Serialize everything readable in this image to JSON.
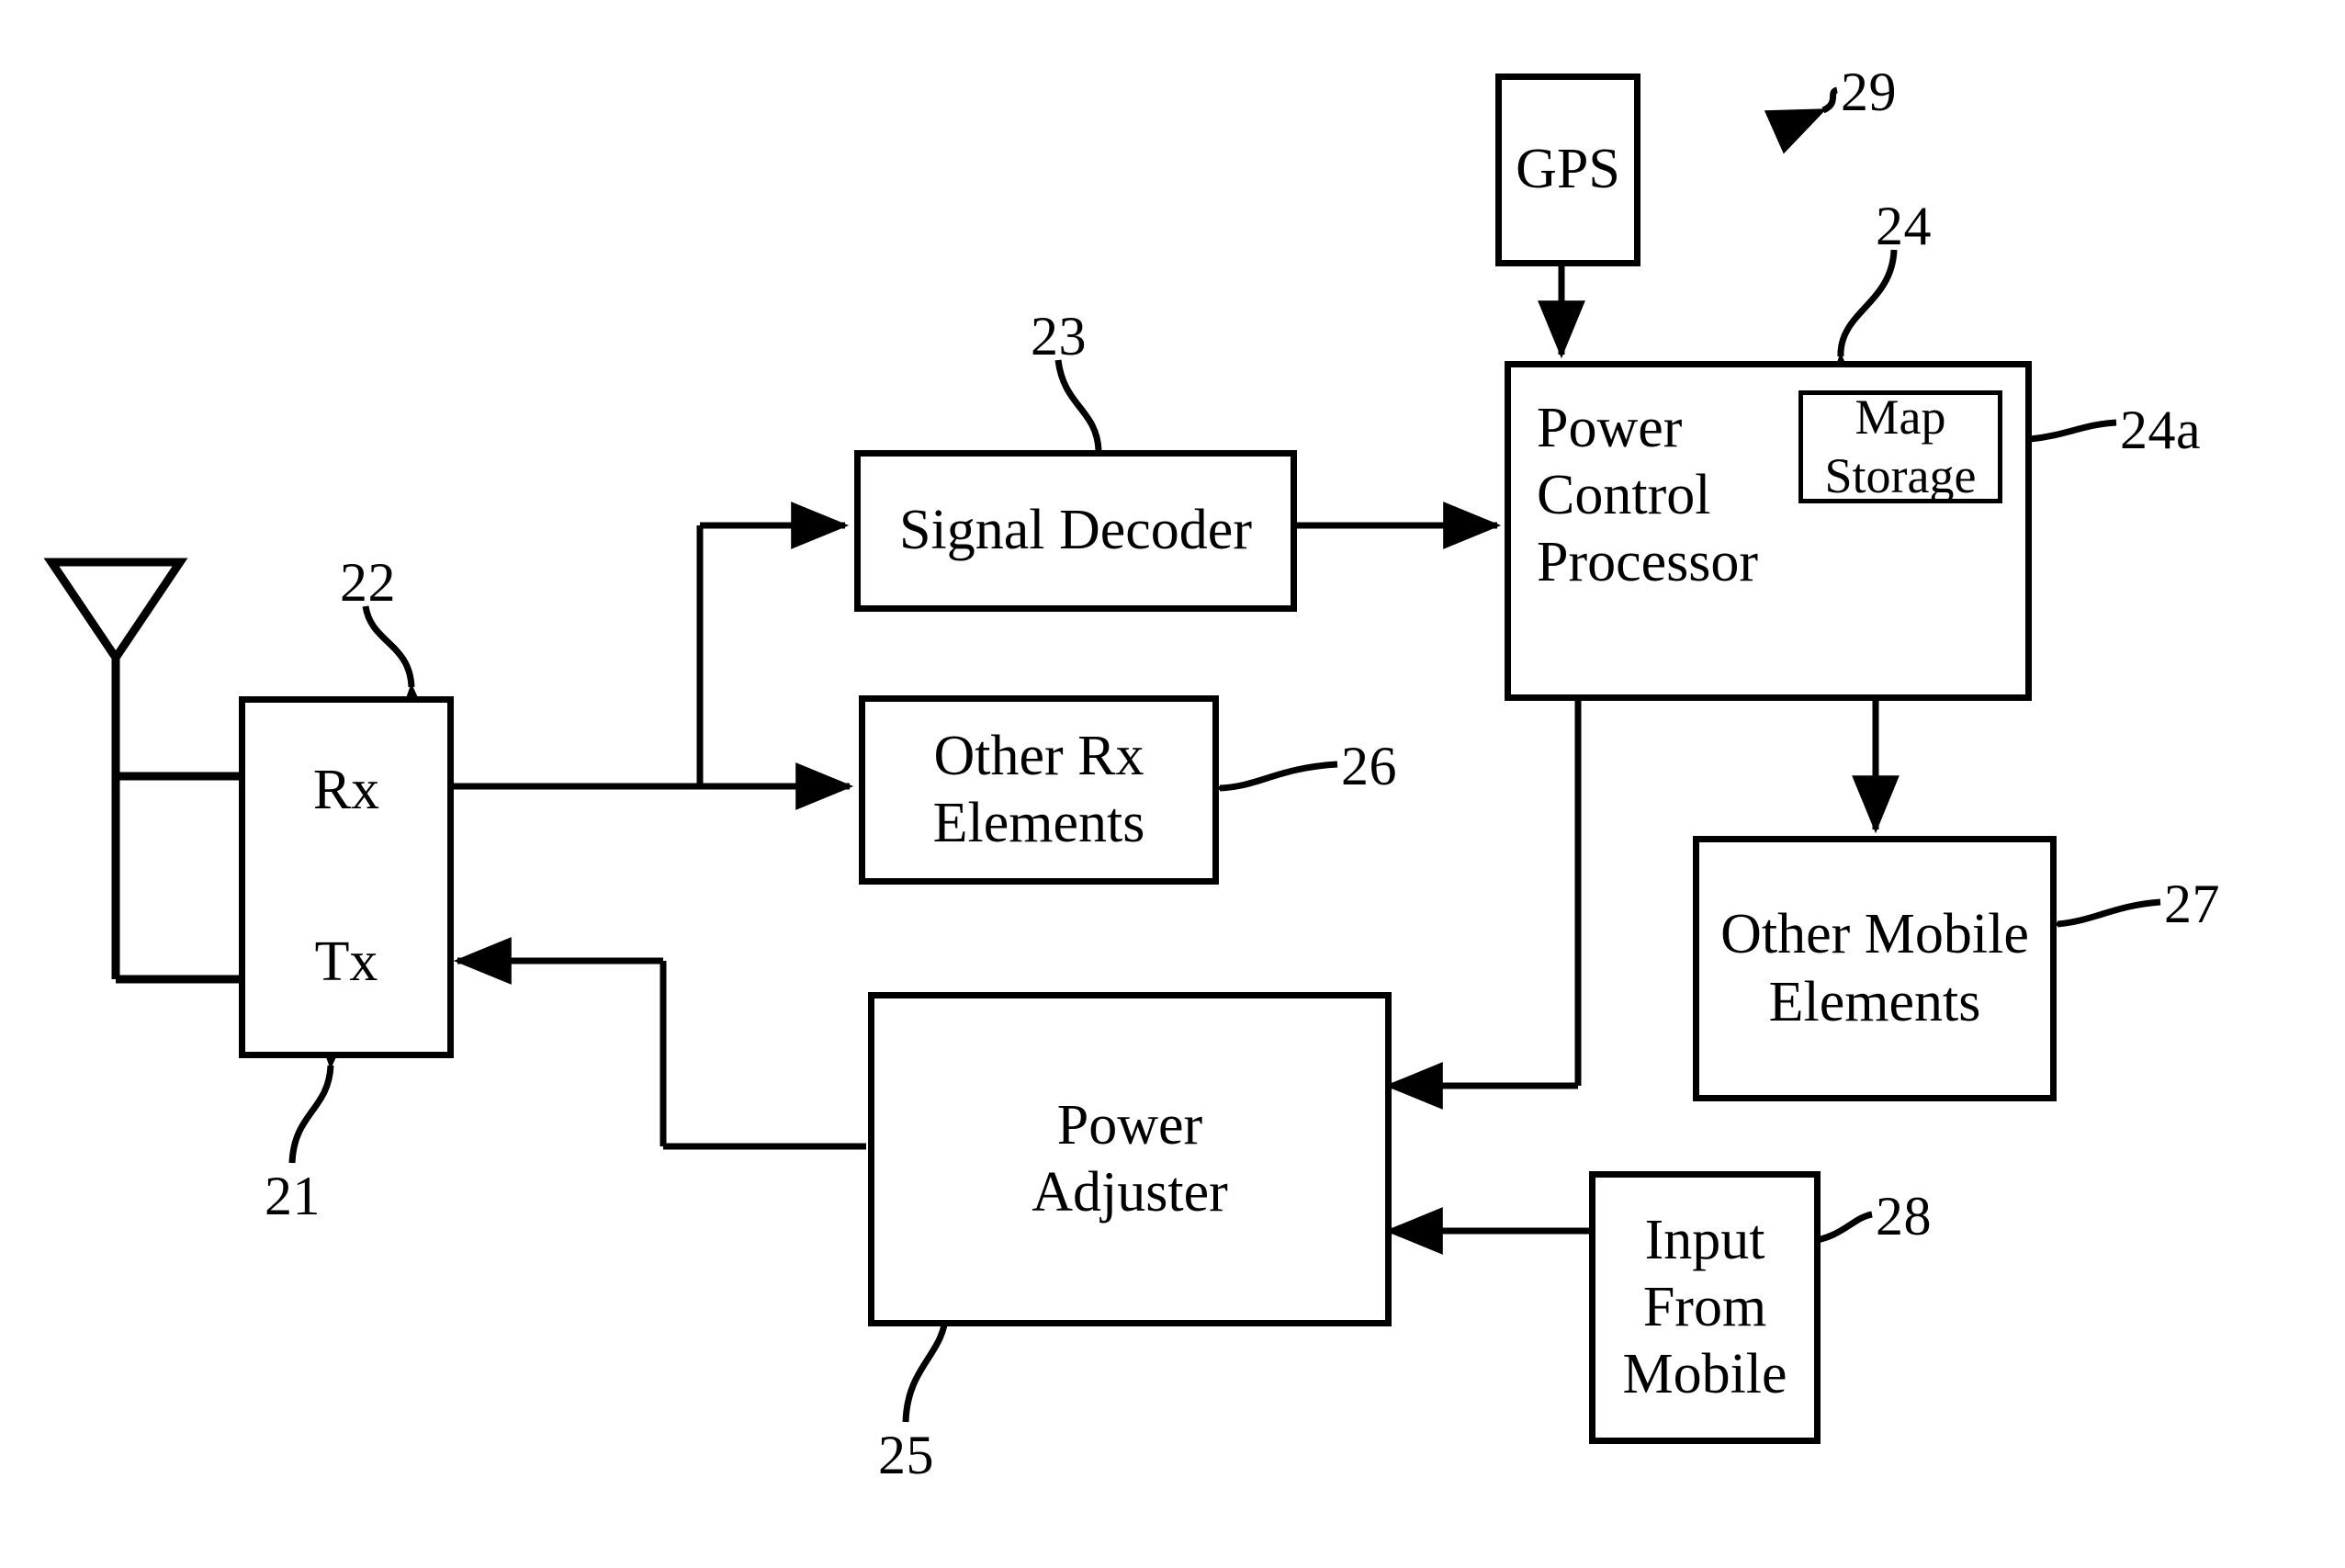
{
  "figure": {
    "type": "patent-block-diagram",
    "title": "Mobile transmit power control block diagram"
  },
  "blocks": {
    "rx": {
      "label": "Rx",
      "ref": "22"
    },
    "tx": {
      "label": "Tx",
      "ref": "21"
    },
    "signal_decoder": {
      "label": "Signal Decoder",
      "ref": "23"
    },
    "other_rx_elements": {
      "label": "Other Rx\nElements",
      "ref": "26"
    },
    "power_adjuster": {
      "label": "Power\nAdjuster",
      "ref": "25"
    },
    "power_control_processor": {
      "label": "Power\nControl\nProcessor",
      "ref": "24"
    },
    "map_storage": {
      "label": "Map\nStorage",
      "ref": "24a"
    },
    "gps": {
      "label": "GPS",
      "ref": "29"
    },
    "other_mobile_elements": {
      "label": "Other Mobile\nElements",
      "ref": "27"
    },
    "input_from_mobile": {
      "label": "Input From\nMobile",
      "ref": "28"
    }
  },
  "reference_numerals": {
    "n21": "21",
    "n22": "22",
    "n23": "23",
    "n24": "24",
    "n24a": "24a",
    "n25": "25",
    "n26": "26",
    "n27": "27",
    "n28": "28",
    "n29": "29"
  },
  "icons": {
    "antenna": "antenna-icon"
  },
  "colors": {
    "ink": "#000000",
    "paper": "#ffffff"
  }
}
